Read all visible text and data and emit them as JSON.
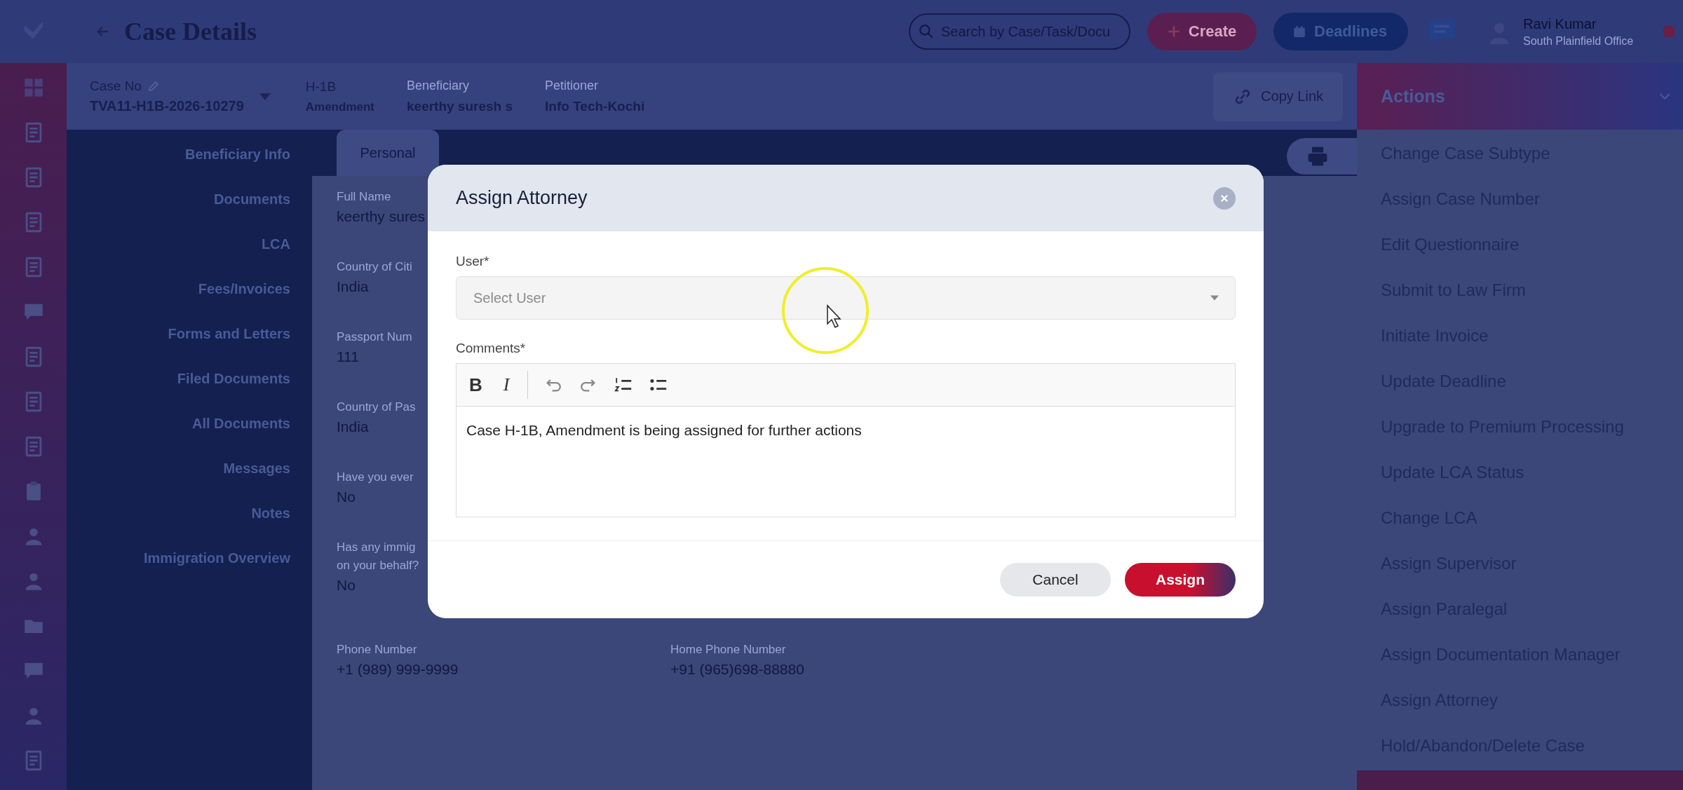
{
  "header": {
    "title": "Case Details",
    "search": {
      "placeholder": "Search by Case/Task/Docu"
    },
    "buttons": [
      {
        "label": "Create",
        "kind": "create"
      },
      {
        "label": "Deadlines",
        "kind": "deadlines"
      }
    ],
    "user": {
      "name": "Ravi Kumar",
      "office": "South Plainfield Office"
    }
  },
  "case_bar": {
    "case_no_label": "Case No",
    "case_no": "TVA11-H1B-2026-10279",
    "case_type": "H-1B",
    "case_subtype": "Amendment",
    "details": [
      {
        "label": "Beneficiary",
        "value": "keerthy suresh s"
      },
      {
        "label": "Petitioner",
        "value": "Info Tech-Kochi"
      }
    ],
    "copy_link": "Copy Link"
  },
  "sidebar": {
    "items": [
      "Beneficiary Info",
      "Documents",
      "LCA",
      "Fees/Invoices",
      "Forms and Letters",
      "Filed Documents",
      "All Documents",
      "Messages",
      "Notes",
      "Immigration Overview"
    ]
  },
  "tabs": [
    {
      "label": "Personal",
      "selected": true
    }
  ],
  "fields": [
    {
      "label": [
        "Full Name"
      ],
      "value": "keerthy sures"
    },
    {
      "label": [
        "Country of Citi"
      ],
      "value": "India"
    },
    {
      "label": [
        "Passport Num"
      ],
      "value": "111"
    },
    {
      "label": [
        "Country of Pas"
      ],
      "value": "India"
    },
    {
      "label": [
        "Have you ever"
      ],
      "value": "No"
    },
    {
      "label": [
        "Has any immig",
        "on your behalf?"
      ],
      "value": "No"
    }
  ],
  "contact_fields": [
    {
      "label": "Phone Number",
      "value": "+1  (989) 999-9999"
    },
    {
      "label": "Home Phone Number",
      "value": "+91  (965)698-88880"
    }
  ],
  "actions": {
    "title": "Actions",
    "items": [
      "Change Case Subtype",
      "Assign Case Number",
      "Edit Questionnaire",
      "Submit to Law Firm",
      "Initiate Invoice",
      "Update Deadline",
      "Upgrade to Premium Processing",
      "Update LCA Status",
      "Change LCA",
      "Assign Supervisor",
      "Assign Paralegal",
      "Assign Documentation Manager",
      "Assign Attorney",
      "Hold/Abandon/Delete Case"
    ]
  },
  "dialog": {
    "title": "Assign Attorney",
    "user_label": "User*",
    "user_select": {
      "placeholder": "Select User"
    },
    "comments_label": "Comments*",
    "toolbar": [
      {
        "label": "B",
        "kind": "bold"
      },
      {
        "label": "I",
        "kind": "italic"
      }
    ],
    "comment": "Case H-1B, Amendment is being assigned for further actions",
    "buttons": [
      {
        "label": "Cancel",
        "kind": "secondary"
      },
      {
        "label": "Assign",
        "kind": "primary"
      }
    ]
  }
}
